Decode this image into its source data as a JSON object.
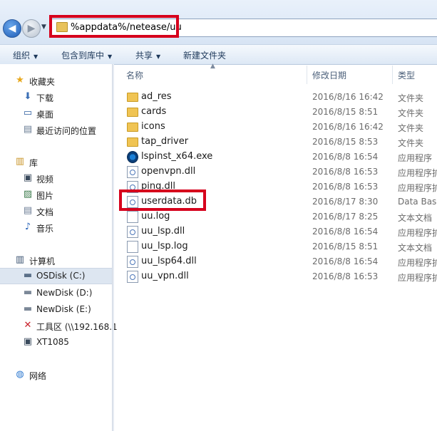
{
  "address": {
    "path": "%appdata%/netease/uu"
  },
  "toolbar": {
    "organize": "组织",
    "include_in_library": "包含到库中",
    "share": "共享",
    "new_folder": "新建文件夹"
  },
  "nav": {
    "favorites": "收藏夹",
    "downloads": "下载",
    "desktop": "桌面",
    "recent": "最近访问的位置",
    "libraries": "库",
    "videos": "视频",
    "pictures": "图片",
    "documents": "文档",
    "music": "音乐",
    "computer": "计算机",
    "drives": [
      "OSDisk (C:)",
      "NewDisk (D:)",
      "NewDisk (E:)",
      "工具区 (\\\\192.168.1",
      "XT1085"
    ],
    "network": "网络"
  },
  "columns": {
    "name": "名称",
    "date": "修改日期",
    "type": "类型"
  },
  "files": [
    {
      "name": "ad_res",
      "date": "2016/8/16 16:42",
      "type": "文件夹",
      "icon": "folder-icon"
    },
    {
      "name": "cards",
      "date": "2016/8/15 8:51",
      "type": "文件夹",
      "icon": "folder-icon"
    },
    {
      "name": "icons",
      "date": "2016/8/16 16:42",
      "type": "文件夹",
      "icon": "folder-icon"
    },
    {
      "name": "tap_driver",
      "date": "2016/8/15 8:53",
      "type": "文件夹",
      "icon": "folder-icon"
    },
    {
      "name": "lspinst_x64.exe",
      "date": "2016/8/8 16:54",
      "type": "应用程序",
      "icon": "exe-icon"
    },
    {
      "name": "openvpn.dll",
      "date": "2016/8/8 16:53",
      "type": "应用程序扩",
      "icon": "dll-icon"
    },
    {
      "name": "ping.dll",
      "date": "2016/8/8 16:53",
      "type": "应用程序扩",
      "icon": "dll-icon"
    },
    {
      "name": "userdata.db",
      "date": "2016/8/17 8:30",
      "type": "Data Base",
      "icon": "db-icon"
    },
    {
      "name": "uu.log",
      "date": "2016/8/17 8:25",
      "type": "文本文档",
      "icon": "document-icon"
    },
    {
      "name": "uu_lsp.dll",
      "date": "2016/8/8 16:54",
      "type": "应用程序扩",
      "icon": "dll-icon"
    },
    {
      "name": "uu_lsp.log",
      "date": "2016/8/15 8:51",
      "type": "文本文档",
      "icon": "document-icon"
    },
    {
      "name": "uu_lsp64.dll",
      "date": "2016/8/8 16:54",
      "type": "应用程序扩",
      "icon": "dll-icon"
    },
    {
      "name": "uu_vpn.dll",
      "date": "2016/8/8 16:53",
      "type": "应用程序扩",
      "icon": "dll-icon"
    }
  ],
  "colors": {
    "highlight": "#d6001c",
    "selection": "#dde6f1",
    "folder": "#f0c453"
  }
}
